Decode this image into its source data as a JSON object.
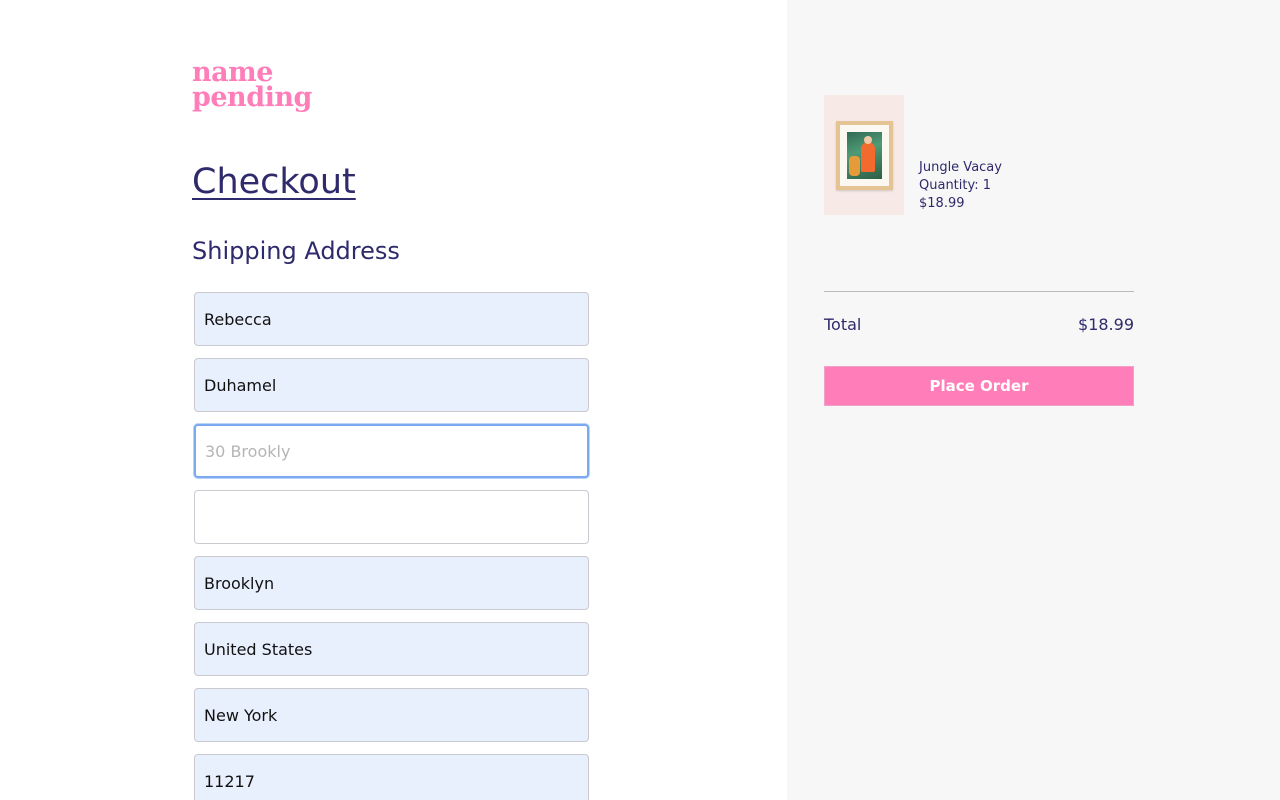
{
  "brand": {
    "line1": "name",
    "line2": "pending",
    "color": "#ff7eb9"
  },
  "page": {
    "title": "Checkout",
    "section_title": "Shipping Address"
  },
  "shipping_form": {
    "first_name": "Rebecca",
    "last_name": "Duhamel",
    "address1": "30 Brookly",
    "address2": "",
    "city": "Brooklyn",
    "country": "United States",
    "state": "New York",
    "zip": "11217"
  },
  "cart": {
    "item": {
      "name": "Jungle Vacay",
      "quantity_text": "Quantity: 1",
      "price": "$18.99",
      "image": "framed-art-print"
    },
    "total_label": "Total",
    "total_value": "$18.99",
    "place_order_label": "Place Order"
  },
  "colors": {
    "accent": "#ff7eb9",
    "text": "#2e2a6b",
    "autofill": "#e8effd",
    "sidebar": "#f7f7f7"
  }
}
